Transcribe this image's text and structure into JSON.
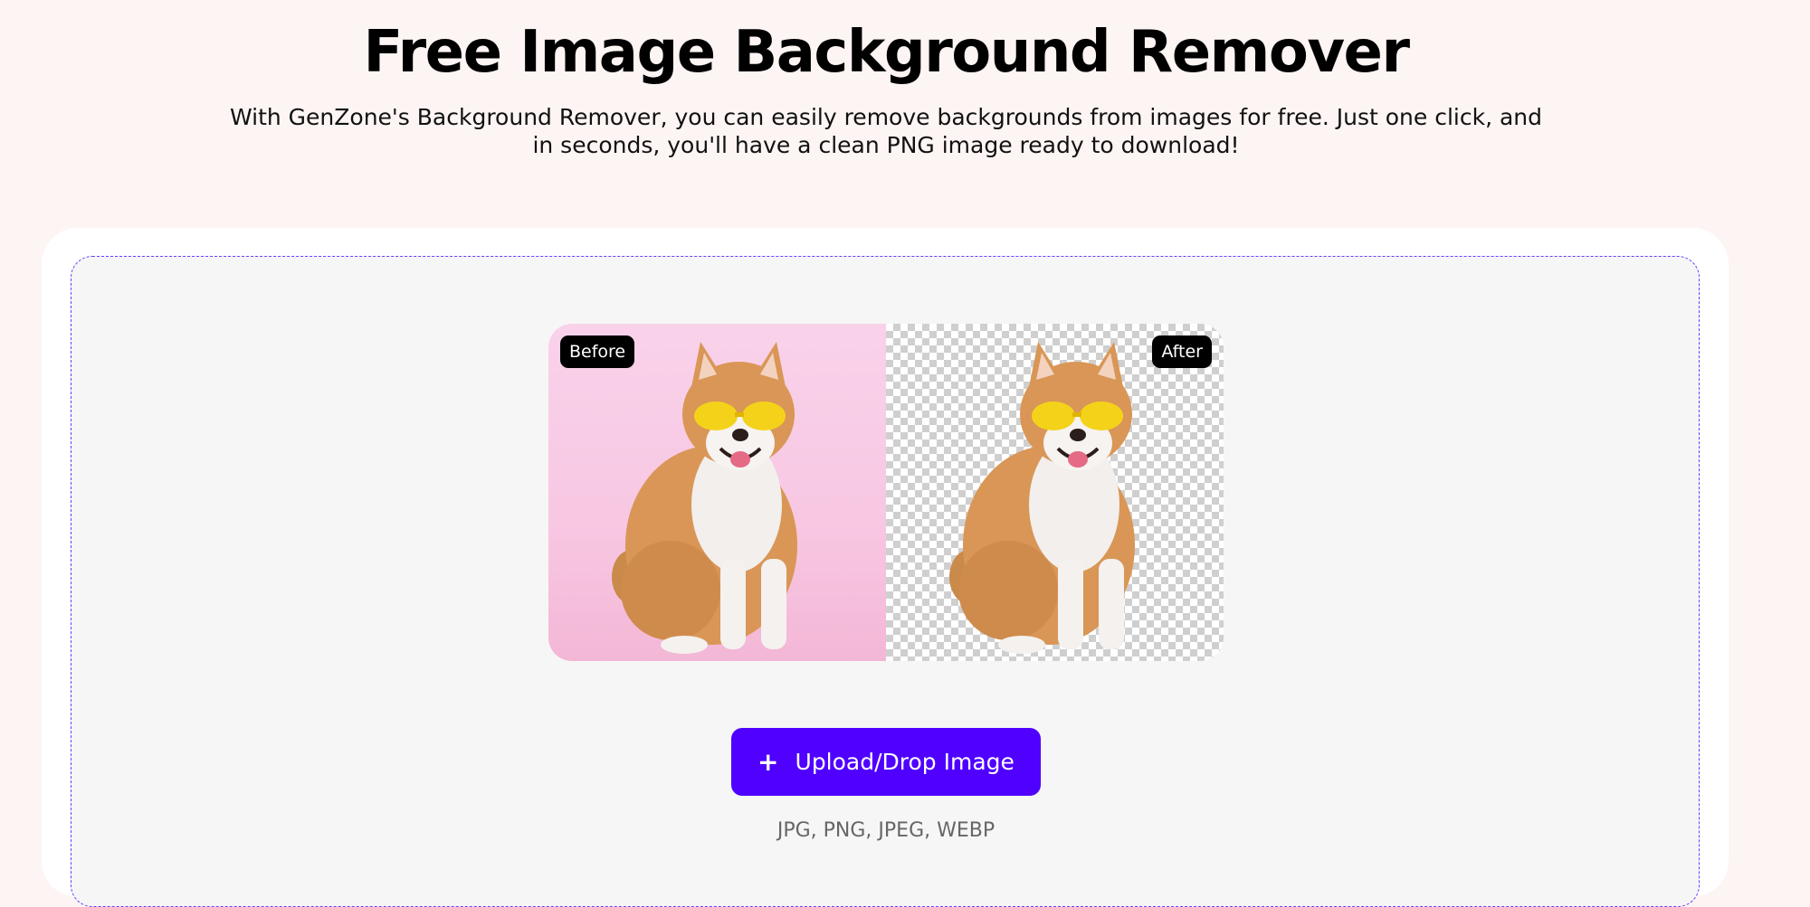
{
  "hero": {
    "title": "Free Image Background Remover",
    "subtitle": "With GenZone's Background Remover, you can easily remove backgrounds from images for free. Just one click, and in seconds, you'll have a clean PNG image ready to download!"
  },
  "preview": {
    "before_label": "Before",
    "after_label": "After"
  },
  "upload": {
    "icon": "plus-icon",
    "button_label": "Upload/Drop Image",
    "formats": "JPG, PNG, JPEG, WEBP"
  },
  "colors": {
    "accent": "#4f00ff",
    "dropzone_border": "#6a3cff",
    "page_background": "#fdf5f3",
    "before_background": "#f9d2ea"
  }
}
